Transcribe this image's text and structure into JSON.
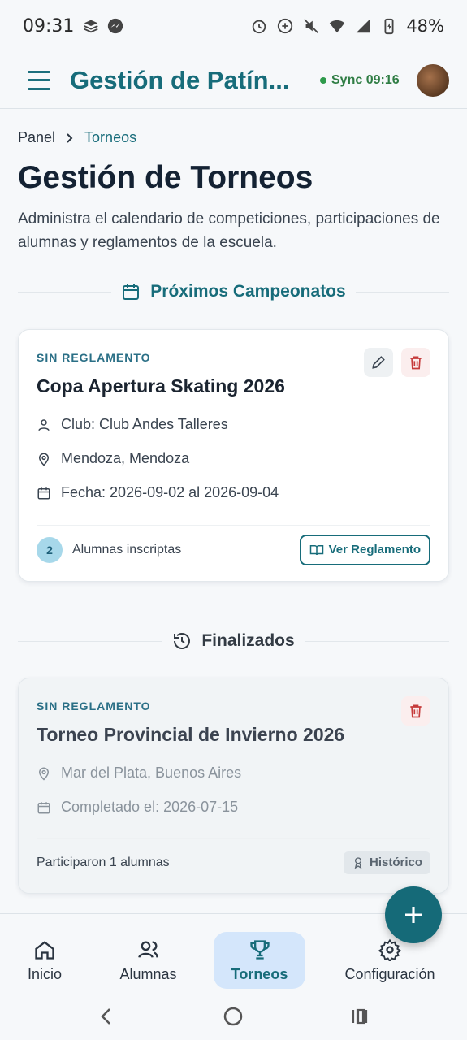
{
  "status_bar": {
    "time": "09:31",
    "battery": "48%"
  },
  "app_bar": {
    "title": "Gestión de Patín...",
    "sync_label": "Sync 09:16",
    "sync_color": "#2e9a4b",
    "accent_color": "#176c7a"
  },
  "breadcrumb": {
    "home": "Panel",
    "current": "Torneos"
  },
  "page": {
    "title": "Gestión de Torneos",
    "description": "Administra el calendario de competiciones, participaciones de alumnas y reglamentos de la escuela."
  },
  "upcoming": {
    "heading": "Próximos Campeonatos",
    "cards": [
      {
        "tag": "SIN REGLAMENTO",
        "title": "Copa Apertura Skating 2026",
        "club": "Club: Club Andes Talleres",
        "location": "Mendoza, Mendoza",
        "dates": "Fecha: 2026-09-02 al 2026-09-04",
        "enrolled_count": "2",
        "enrolled_label": "Alumnas inscriptas",
        "rules_button": "Ver Reglamento"
      }
    ]
  },
  "finished": {
    "heading": "Finalizados",
    "cards": [
      {
        "tag": "SIN REGLAMENTO",
        "title": "Torneo Provincial de Invierno 2026",
        "location": "Mar del Plata, Buenos Aires",
        "completed": "Completado el: 2026-07-15",
        "participants": "Participaron 1 alumnas",
        "badge": "Histórico"
      }
    ]
  },
  "bottom_nav": [
    {
      "label": "Inicio",
      "icon": "home-icon"
    },
    {
      "label": "Alumnas",
      "icon": "users-icon"
    },
    {
      "label": "Torneos",
      "icon": "trophy-icon",
      "active": true
    },
    {
      "label": "Configuración",
      "icon": "gear-icon"
    }
  ]
}
